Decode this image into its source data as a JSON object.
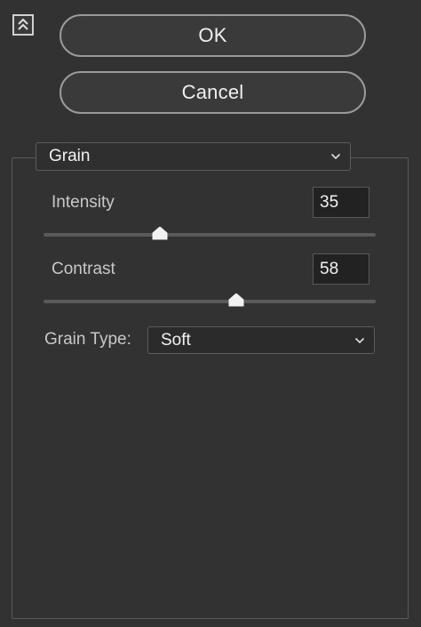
{
  "panel": {
    "collapse_icon": "double-chevron-up-icon"
  },
  "buttons": {
    "ok_label": "OK",
    "cancel_label": "Cancel"
  },
  "filter": {
    "selected": "Grain",
    "chevron_icon": "chevron-down-icon"
  },
  "params": {
    "intensity": {
      "label": "Intensity",
      "value": "35",
      "level": 0.35
    },
    "contrast": {
      "label": "Contrast",
      "value": "58",
      "level": 0.58
    },
    "grain_type": {
      "label": "Grain Type:",
      "selected": "Soft"
    }
  },
  "colors": {
    "background": "#323232",
    "button_border": "#9a9a9a",
    "track": "#5a5a5a",
    "thumb": "#f2f2f2"
  }
}
